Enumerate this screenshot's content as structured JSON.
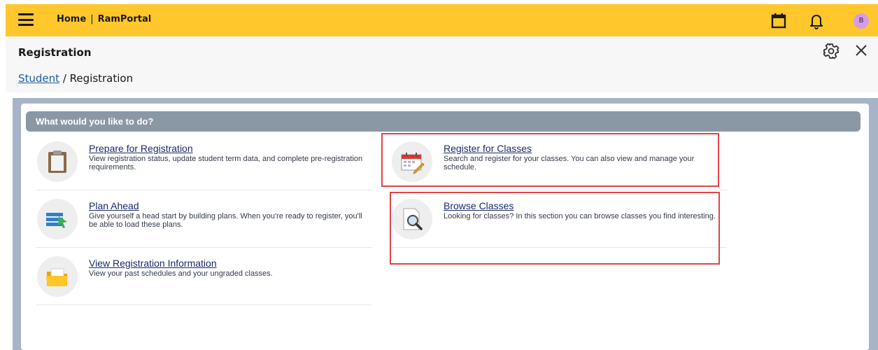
{
  "topbar": {
    "home_label": "Home",
    "separator": "|",
    "portal_label": "RamPortal",
    "avatar_initial": "B",
    "accent_color": "#ffc72c"
  },
  "header": {
    "title": "Registration",
    "breadcrumb_link": "Student",
    "breadcrumb_separator": " / ",
    "breadcrumb_current": "Registration"
  },
  "main": {
    "prompt": "What would you like to do?",
    "items": [
      {
        "title": "Prepare for Registration",
        "description": "View registration status, update student term data, and complete pre-registration requirements.",
        "icon": "clipboard-icon"
      },
      {
        "title": "Register for Classes",
        "description": "Search and register for your classes. You can also view and manage your schedule.",
        "icon": "calendar-pencil-icon"
      },
      {
        "title": "Plan Ahead",
        "description": "Give yourself a head start by building plans. When you're ready to register, you'll be able to load these plans.",
        "icon": "plan-list-icon"
      },
      {
        "title": "Browse Classes",
        "description": "Looking for classes? In this section you can browse classes you find interesting.",
        "icon": "document-search-icon"
      },
      {
        "title": "View Registration Information",
        "description": "View your past schedules and your ungraded classes.",
        "icon": "folder-icon"
      }
    ]
  }
}
